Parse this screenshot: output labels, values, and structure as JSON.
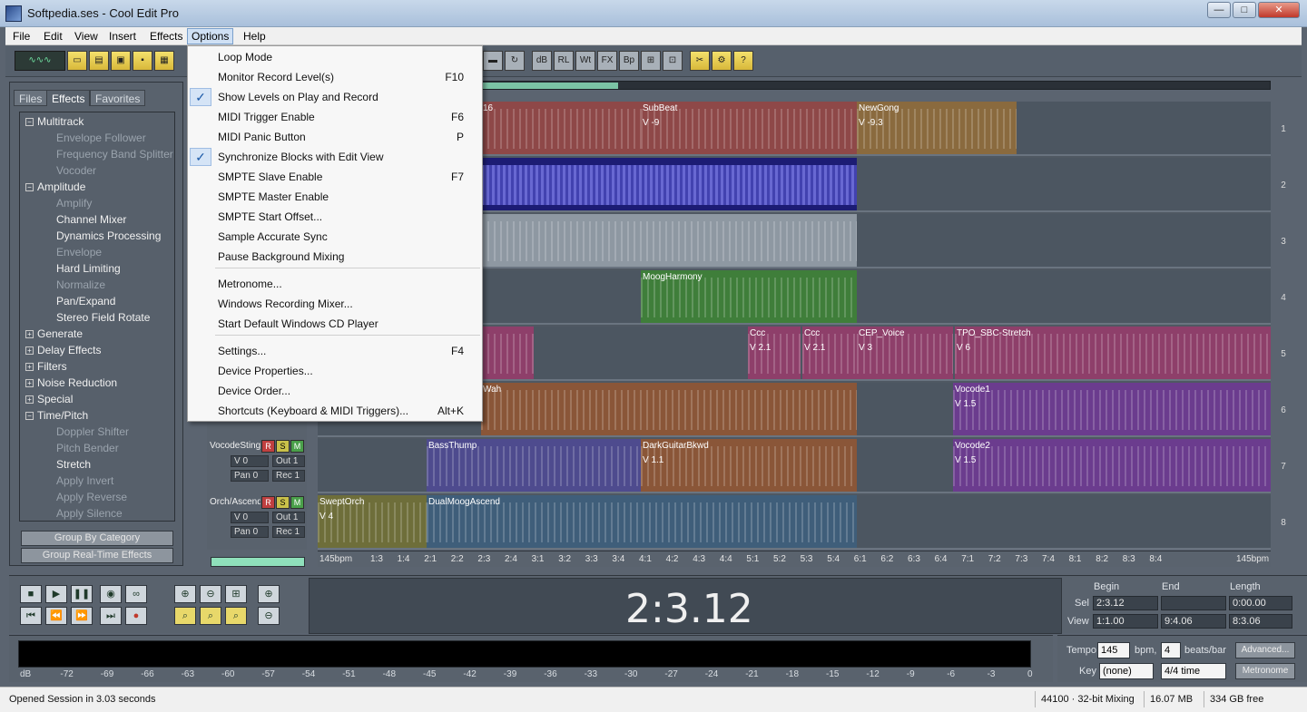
{
  "window": {
    "title": "Softpedia.ses - Cool Edit Pro",
    "minimize": "—",
    "maximize": "□",
    "close": "✕"
  },
  "menubar": {
    "items": [
      "File",
      "Edit",
      "View",
      "Insert",
      "Effects",
      "Options",
      "Help"
    ]
  },
  "toolbar": {
    "waveform_label": "∿∿∿"
  },
  "panel": {
    "tabs": [
      "Files",
      "Effects",
      "Favorites"
    ],
    "tree": [
      {
        "label": "Multitrack",
        "kind": "grp",
        "box": "−"
      },
      {
        "label": "Envelope Follower",
        "kind": "off"
      },
      {
        "label": "Frequency Band Splitter",
        "kind": "off"
      },
      {
        "label": "Vocoder",
        "kind": "off"
      },
      {
        "label": "Amplitude",
        "kind": "grp",
        "box": "−"
      },
      {
        "label": "Amplify",
        "kind": "off"
      },
      {
        "label": "Channel Mixer",
        "kind": "on"
      },
      {
        "label": "Dynamics Processing",
        "kind": "on"
      },
      {
        "label": "Envelope",
        "kind": "off"
      },
      {
        "label": "Hard Limiting",
        "kind": "on"
      },
      {
        "label": "Normalize",
        "kind": "off"
      },
      {
        "label": "Pan/Expand",
        "kind": "on"
      },
      {
        "label": "Stereo Field Rotate",
        "kind": "on"
      },
      {
        "label": "Generate",
        "kind": "grp",
        "box": "+"
      },
      {
        "label": "Delay Effects",
        "kind": "grp",
        "box": "+"
      },
      {
        "label": "Filters",
        "kind": "grp",
        "box": "+"
      },
      {
        "label": "Noise Reduction",
        "kind": "grp",
        "box": "+"
      },
      {
        "label": "Special",
        "kind": "grp",
        "box": "+"
      },
      {
        "label": "Time/Pitch",
        "kind": "grp",
        "box": "−"
      },
      {
        "label": "Doppler Shifter",
        "kind": "off"
      },
      {
        "label": "Pitch Bender",
        "kind": "off"
      },
      {
        "label": "Stretch",
        "kind": "on"
      },
      {
        "label": "Apply Invert",
        "kind": "off"
      },
      {
        "label": "Apply Reverse",
        "kind": "off"
      },
      {
        "label": "Apply Silence",
        "kind": "off"
      }
    ],
    "group_by_category": "Group By Category",
    "group_realtime": "Group Real-Time Effects"
  },
  "options_menu": {
    "items": [
      {
        "label": "Loop Mode",
        "shortcut": "",
        "checked": false
      },
      {
        "label": "Monitor Record Level(s)",
        "shortcut": "F10",
        "checked": false
      },
      {
        "label": "Show Levels on Play and Record",
        "shortcut": "",
        "checked": true
      },
      {
        "label": "MIDI Trigger Enable",
        "shortcut": "F6",
        "checked": false
      },
      {
        "label": "MIDI Panic Button",
        "shortcut": "P",
        "checked": false
      },
      {
        "label": "Synchronize Blocks with Edit View",
        "shortcut": "",
        "checked": true
      },
      {
        "label": "SMPTE Slave Enable",
        "shortcut": "F7",
        "checked": false
      },
      {
        "label": "SMPTE Master Enable",
        "shortcut": "",
        "checked": false
      },
      {
        "label": "SMPTE Start Offset...",
        "shortcut": "",
        "checked": false
      },
      {
        "label": "Sample Accurate Sync",
        "shortcut": "",
        "checked": false
      },
      {
        "label": "Pause Background Mixing",
        "shortcut": "",
        "checked": false
      },
      {
        "label": "Metronome...",
        "shortcut": "",
        "checked": false
      },
      {
        "label": "Windows Recording Mixer...",
        "shortcut": "",
        "checked": false
      },
      {
        "label": "Start Default Windows CD Player",
        "shortcut": "",
        "checked": false
      },
      {
        "label": "Settings...",
        "shortcut": "F4",
        "checked": false
      },
      {
        "label": "Device Properties...",
        "shortcut": "",
        "checked": false
      },
      {
        "label": "Device Order...",
        "shortcut": "",
        "checked": false
      },
      {
        "label": "Shortcuts (Keyboard & MIDI Triggers)...",
        "shortcut": "Alt+K",
        "checked": false
      }
    ]
  },
  "track_controls": [
    {
      "name": "VocodeSting",
      "r": "R",
      "s": "S",
      "m": "M",
      "vol": "V 0",
      "out": "Out 1",
      "pan": "Pan 0",
      "rec": "Rec 1"
    },
    {
      "name": "Orch/Ascend",
      "r": "R",
      "s": "S",
      "m": "M",
      "vol": "V 0",
      "out": "Out 1",
      "pan": "Pan 0",
      "rec": "Rec 1"
    }
  ],
  "tracks": [
    {
      "no": "1",
      "clips": [
        {
          "name": "16",
          "vol": "",
          "color": "#8e4848"
        },
        {
          "name": "SubBeat",
          "vol": "V -9",
          "color": "#8e4848"
        },
        {
          "name": "NewGong",
          "vol": "V -9.3",
          "color": "#8a6a3e"
        }
      ]
    },
    {
      "no": "2",
      "clips": [
        {
          "name": "",
          "vol": "",
          "color": "#1c1c74"
        }
      ]
    },
    {
      "no": "3",
      "clips": [
        {
          "name": "",
          "vol": "",
          "color": "#8e98a2"
        }
      ]
    },
    {
      "no": "4",
      "clips": [
        {
          "name": "MoogHarmony",
          "vol": "",
          "color": "#3f7e3a"
        }
      ]
    },
    {
      "no": "5",
      "clips": [
        {
          "name": "",
          "vol": "",
          "color": "#8e3f6a"
        },
        {
          "name": "Ccc",
          "vol": "V 2.1",
          "color": "#8e3f6a"
        },
        {
          "name": "Ccc",
          "vol": "V 2.1",
          "color": "#8e3f6a"
        },
        {
          "name": "CEP_Voice",
          "vol": "V 3",
          "color": "#8e3f6a"
        },
        {
          "name": "TPO_SBC-Stretch",
          "vol": "V 6",
          "color": "#8e3f6a"
        }
      ]
    },
    {
      "no": "6",
      "clips": [
        {
          "name": "Wah",
          "vol": "",
          "color": "#8a5638"
        },
        {
          "name": "Vocode1",
          "vol": "V 1.5",
          "color": "#6b3c8e"
        }
      ]
    },
    {
      "no": "7",
      "clips": [
        {
          "name": "BassThump",
          "vol": "",
          "color": "#4e4b8e"
        },
        {
          "name": "DarkGuitarBkwd",
          "vol": "V 1.1",
          "color": "#8a5638"
        },
        {
          "name": "Vocode2",
          "vol": "V 1.5",
          "color": "#6b3c8e"
        }
      ]
    },
    {
      "no": "8",
      "clips": [
        {
          "name": "SweptOrch",
          "vol": "V 4",
          "color": "#6e6e3a"
        },
        {
          "name": "DualMoogAscend",
          "vol": "",
          "color": "#3f5e7a"
        }
      ]
    }
  ],
  "ruler": [
    "145bpm",
    "1:3",
    "1:4",
    "2:1",
    "2:2",
    "2:3",
    "2:4",
    "3:1",
    "3:2",
    "3:3",
    "3:4",
    "4:1",
    "4:2",
    "4:3",
    "4:4",
    "5:1",
    "5:2",
    "5:3",
    "5:4",
    "6:1",
    "6:2",
    "6:3",
    "6:4",
    "7:1",
    "7:2",
    "7:3",
    "7:4",
    "8:1",
    "8:2",
    "8:3",
    "8:4",
    "145bpm"
  ],
  "transport": {
    "time": "2:3.12"
  },
  "selview": {
    "headers": [
      "Begin",
      "End",
      "Length"
    ],
    "sel_label": "Sel",
    "view_label": "View",
    "sel": [
      "2:3.12",
      "",
      "0:00.00"
    ],
    "view": [
      "1:1.00",
      "9:4.06",
      "8:3.06"
    ]
  },
  "meter": {
    "labels": [
      "dB",
      "-72",
      "-69",
      "-66",
      "-63",
      "-60",
      "-57",
      "-54",
      "-51",
      "-48",
      "-45",
      "-42",
      "-39",
      "-36",
      "-33",
      "-30",
      "-27",
      "-24",
      "-21",
      "-18",
      "-15",
      "-12",
      "-9",
      "-6",
      "-3",
      "0"
    ]
  },
  "tempo": {
    "label": "Tempo",
    "value": "145",
    "bpm": "bpm,",
    "beats": "4",
    "beats_label": "beats/bar",
    "key_label": "Key",
    "key": "(none)",
    "time_sig": "4/4 time",
    "advanced": "Advanced...",
    "metronome": "Metronome"
  },
  "status": {
    "message": "Opened Session in 3.03 seconds",
    "format": "44100 · 32-bit Mixing",
    "memory": "16.07 MB",
    "disk": "334 GB free"
  }
}
